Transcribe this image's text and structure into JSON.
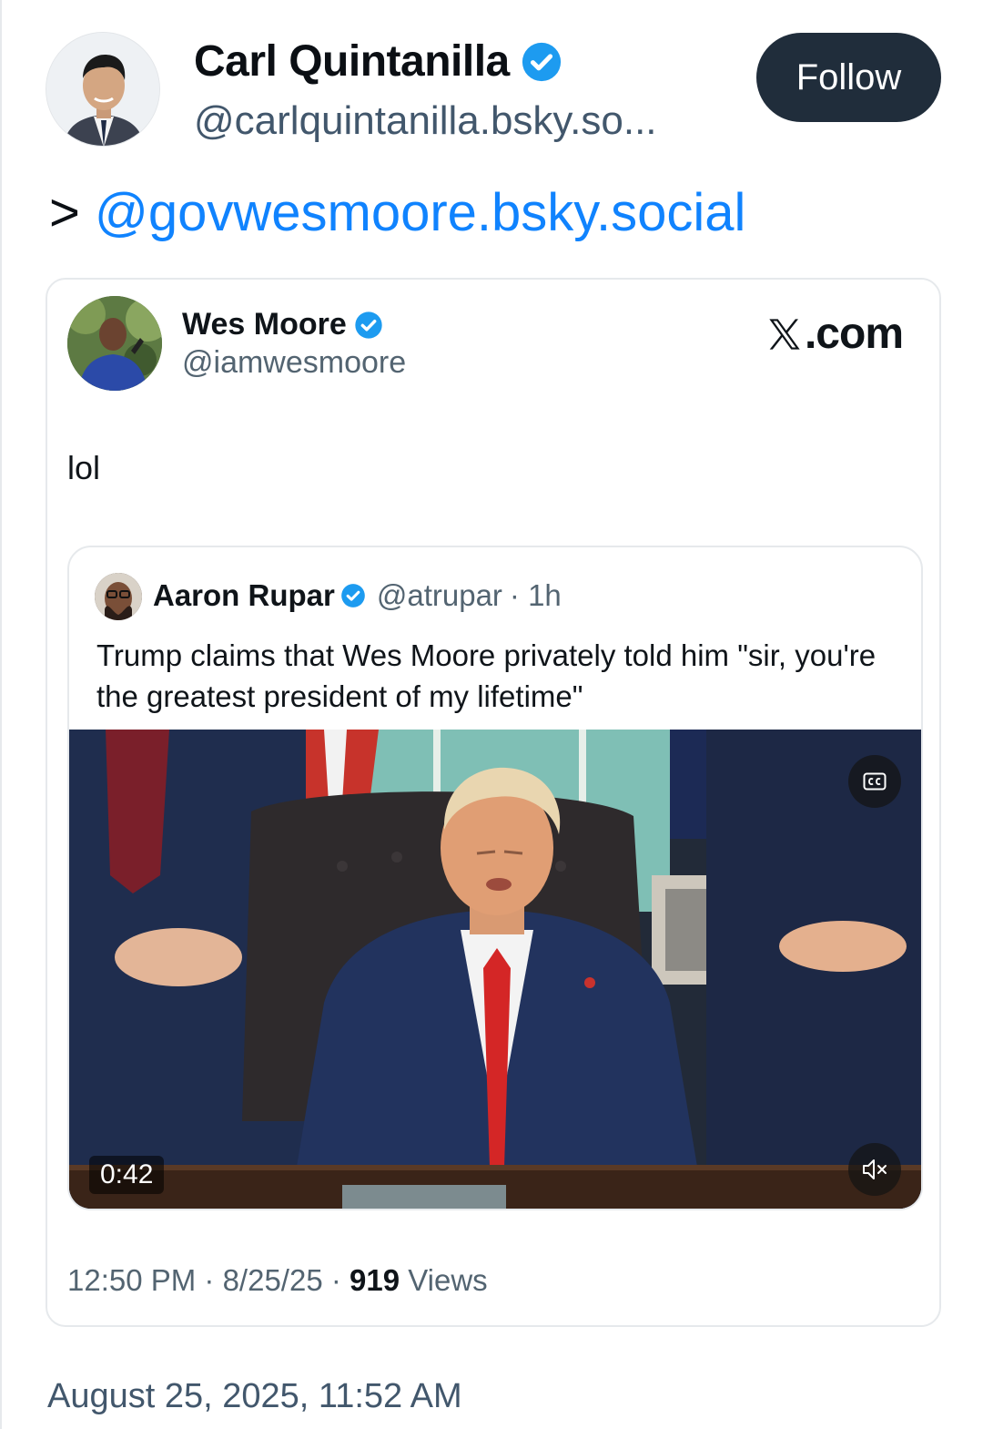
{
  "author": {
    "display_name": "Carl Quintanilla",
    "handle": "@carlquintanilla.bsky.so...",
    "verified": true
  },
  "follow_button": {
    "label": "Follow"
  },
  "post": {
    "prefix": ">",
    "mention": "@govwesmoore.bsky.social"
  },
  "embed": {
    "display_name": "Wes Moore",
    "handle": "@iamwesmoore",
    "source": ".com",
    "body": "lol",
    "quoted": {
      "display_name": "Aaron Rupar",
      "handle": "@atrupar",
      "time": "· 1h",
      "text": "Trump claims that Wes Moore privately told him \"sir, you're the greatest president of my lifetime\"",
      "video": {
        "duration": "0:42",
        "captions_icon": "cc-icon",
        "mute_icon": "muted-speaker-icon"
      }
    },
    "meta": {
      "time": "12:50 PM · 8/25/25 ·",
      "views_count": "919",
      "views_label": "Views"
    }
  },
  "post_date": "August 25, 2025, 11:52 AM",
  "colors": {
    "link": "#1083fe",
    "follow_bg": "#202d3b",
    "verified": "#1d9bf0",
    "secondary_text": "#42576c"
  }
}
